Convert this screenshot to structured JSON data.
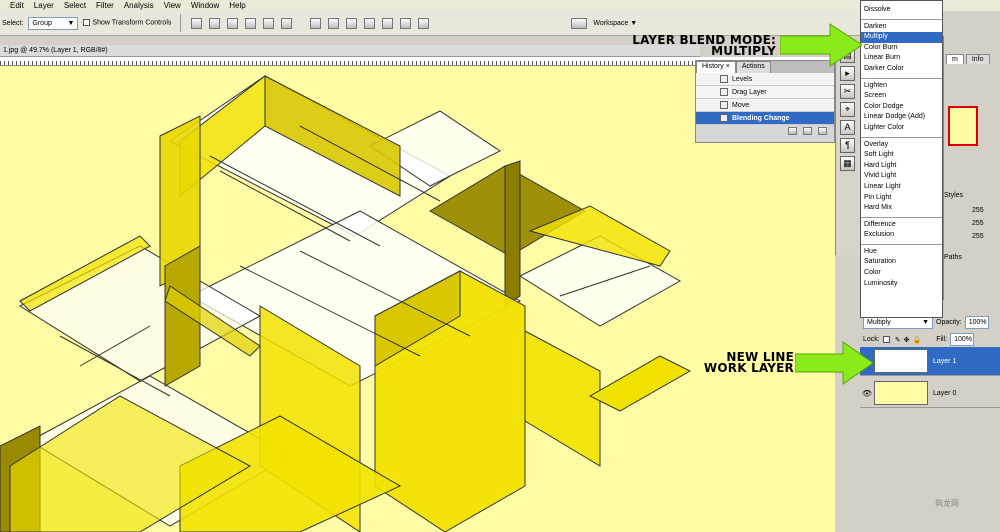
{
  "menubar": {
    "items": [
      "Edit",
      "Layer",
      "Select",
      "Filter",
      "Analysis",
      "View",
      "Window",
      "Help"
    ]
  },
  "options_bar": {
    "select_label": "Select:",
    "select_value": "Group",
    "show_transform_label": "Show Transform Controls",
    "workspace_label": "Workspace"
  },
  "document": {
    "title": "1.jpg @ 49.7% (Layer 1, RGB/8#)"
  },
  "history_panel": {
    "tabs": [
      "History",
      "Actions"
    ],
    "items": [
      {
        "label": "Levels"
      },
      {
        "label": "Drag Layer"
      },
      {
        "label": "Move"
      },
      {
        "label": "Blending Change",
        "active": true
      }
    ]
  },
  "blend_modes": {
    "groups": [
      [
        "Dissolve"
      ],
      [
        "Darken",
        "Multiply",
        "Color Burn",
        "Linear Burn",
        "Darker Color"
      ],
      [
        "Lighten",
        "Screen",
        "Color Dodge",
        "Linear Dodge (Add)",
        "Lighter Color"
      ],
      [
        "Overlay",
        "Soft Light",
        "Hard Light",
        "Vivid Light",
        "Linear Light",
        "Pin Light",
        "Hard Mix"
      ],
      [
        "Difference",
        "Exclusion"
      ],
      [
        "Hue",
        "Saturation",
        "Color",
        "Luminosity"
      ]
    ],
    "selected": "Multiply"
  },
  "side_panel": {
    "tab_labels": [
      "m",
      "Info"
    ],
    "styles_tab": "Styles",
    "values": [
      "255",
      "255",
      "255"
    ],
    "paths_tab": "Paths"
  },
  "layers_panel": {
    "blend_value": "Multiply",
    "opacity_label": "Opacity:",
    "opacity_value": "100%",
    "lock_label": "Lock:",
    "fill_label": "Fill:",
    "fill_value": "100%",
    "layers": [
      {
        "name": "Layer 1",
        "active": true
      },
      {
        "name": "Layer 0",
        "active": false
      }
    ]
  },
  "annotations": {
    "blend_mode_line1": "LAYER BLEND MODE:",
    "blend_mode_line2": "MULTIPLY",
    "new_layer_line1": "NEW LINE",
    "new_layer_line2": "WORK LAYER"
  },
  "colors": {
    "canvas": "#fffca6",
    "yellow": "#f2e200",
    "dark_yellow": "#9a8a00",
    "arrow": "#8bea1c",
    "selection": "#316ac5"
  },
  "watermark": "筑龙网"
}
